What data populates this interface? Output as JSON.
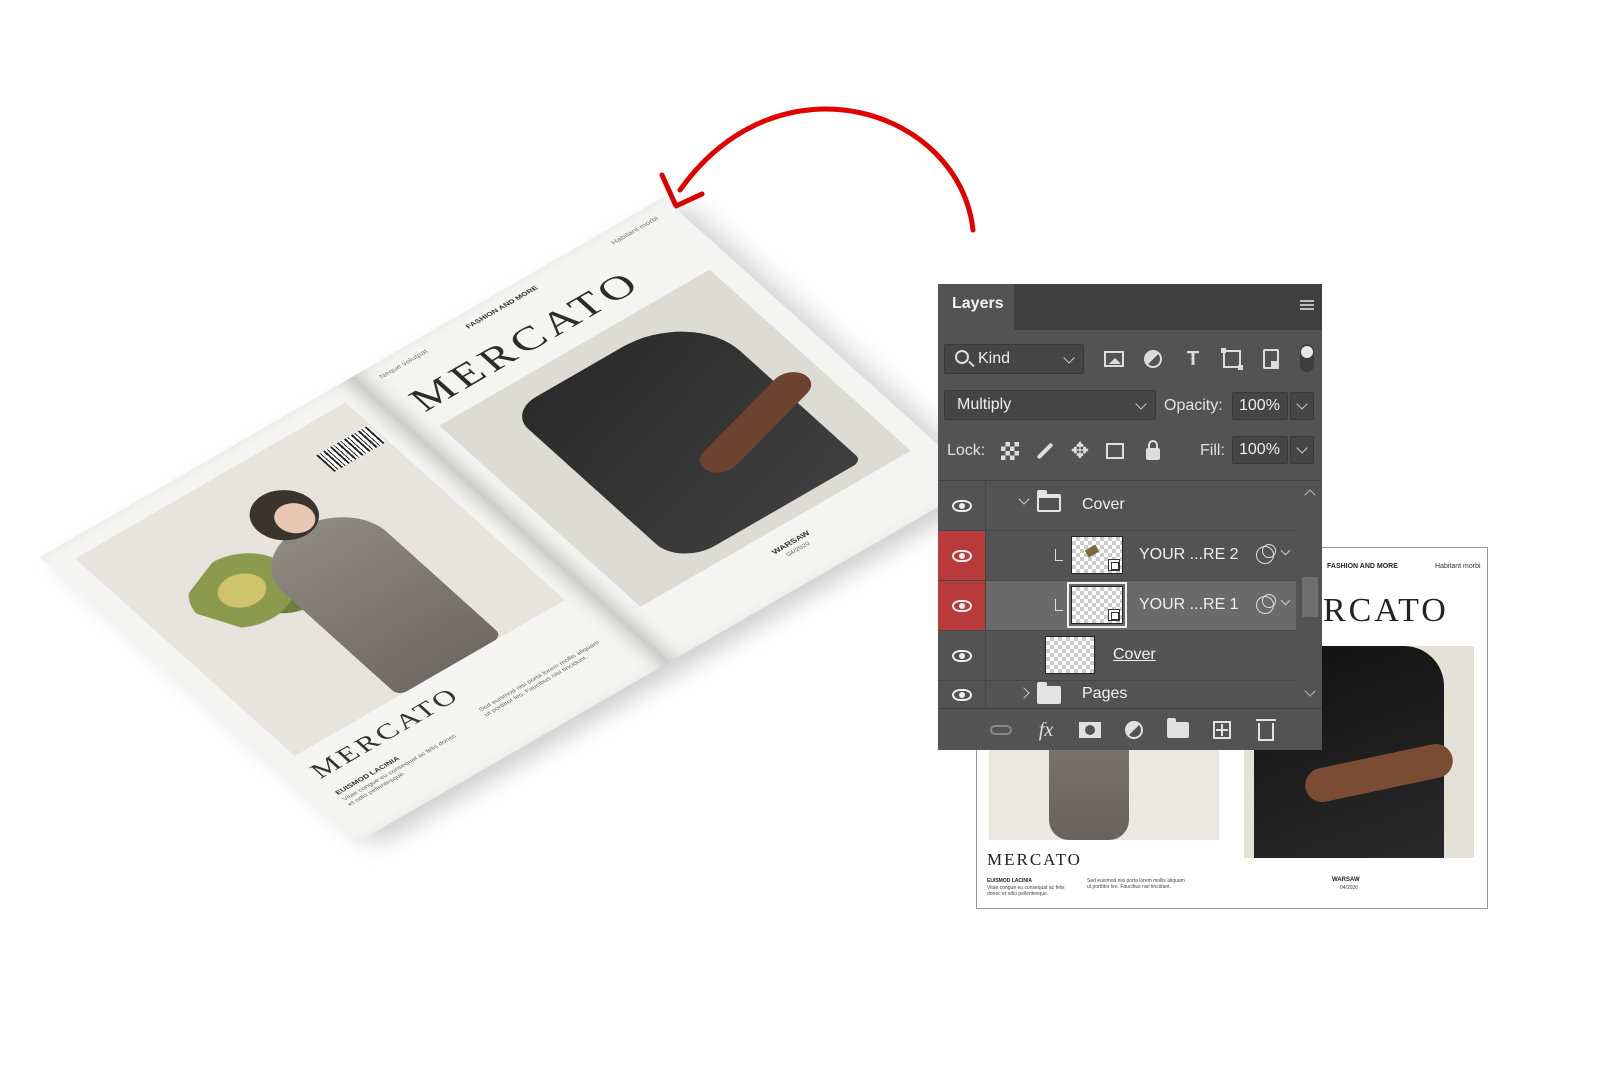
{
  "accent_color": "#e00000",
  "magazine": {
    "front": {
      "top_left": "Neque volutpat",
      "top_mid": "FASHION AND MORE",
      "top_right": "Habitant morbi",
      "brand": "MERCATO",
      "city": "WARSAW",
      "date": "04/2020"
    },
    "back": {
      "brand": "MERCATO",
      "label": "EUISMOD LACINIA",
      "text1": "Vitae congue eu consequat ac felis donec et odio pellentesque.",
      "text2": "Sed euismod nisi porta lorem mollis aliquam ut porttitor leo. Faucibus nisl tincidunt."
    }
  },
  "preview": {
    "fashion": "FASHION AND MORE",
    "habitant": "Habitant morbi",
    "brand_right": "RCATO",
    "brand_left": "MERCATO",
    "label": "EUISMOD LACINIA",
    "text1": "Vitae congue eu consequat ac felis donec et odio pellentesque.",
    "text2": "Sed euismod nisi porta lorem mollis aliquam ut porttitor leo. Faucibus nisl tincidunt.",
    "city": "WARSAW",
    "date": "04/2020"
  },
  "layers_panel": {
    "tab_title": "Layers",
    "filter": {
      "kind_label": "Kind"
    },
    "blend_mode": "Multiply",
    "opacity_label": "Opacity:",
    "opacity_value": "100%",
    "lock_label": "Lock:",
    "fill_label": "Fill:",
    "fill_value": "100%",
    "layers": [
      {
        "name": "Cover",
        "type": "group",
        "expanded": true
      },
      {
        "name": "YOUR ...RE 2",
        "type": "smart-object",
        "clipped": true,
        "eye_highlight": true
      },
      {
        "name": "YOUR ...RE 1",
        "type": "smart-object",
        "clipped": true,
        "eye_highlight": true,
        "selected": true
      },
      {
        "name": "Cover",
        "type": "smart-object-base"
      },
      {
        "name": "Pages",
        "type": "group",
        "expanded": false
      }
    ]
  }
}
